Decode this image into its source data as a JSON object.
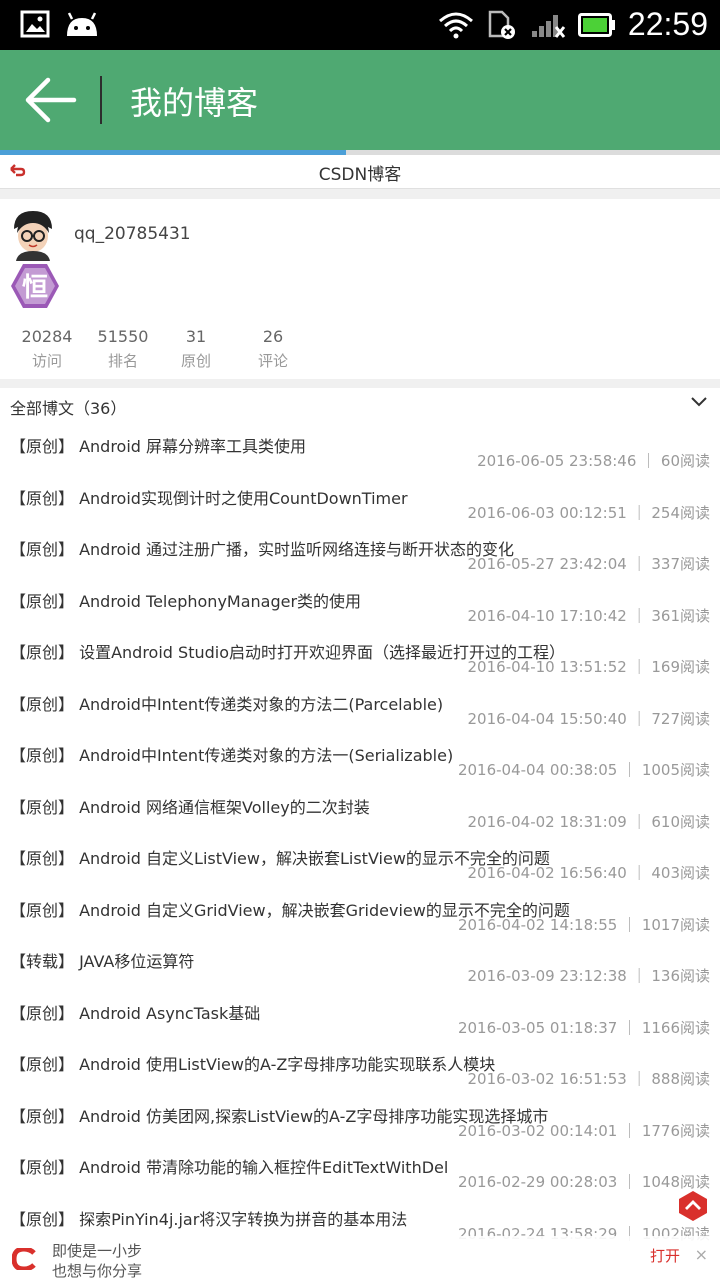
{
  "status_bar": {
    "time": "22:59"
  },
  "app_bar": {
    "title": "我的博客"
  },
  "loading": {
    "progress_percent": 48
  },
  "sub_bar": {
    "title": "CSDN博客"
  },
  "profile": {
    "username": "qq_20785431",
    "badge_char": "恒",
    "stats": [
      {
        "value": "20284",
        "label": "访问"
      },
      {
        "value": "51550",
        "label": "排名"
      },
      {
        "value": "31",
        "label": "原创"
      },
      {
        "value": "26",
        "label": "评论"
      }
    ]
  },
  "list_header": "全部博文（36）",
  "articles": [
    {
      "title": "【原创】 Android 屏幕分辨率工具类使用",
      "meta": "2016-06-05 23:58:46 ｜ 60阅读"
    },
    {
      "title": "【原创】 Android实现倒计时之使用CountDownTimer",
      "meta": "2016-06-03 00:12:51 ｜ 254阅读"
    },
    {
      "title": "【原创】 Android 通过注册广播，实时监听网络连接与断开状态的变化",
      "meta": "2016-05-27 23:42:04 ｜ 337阅读"
    },
    {
      "title": "【原创】 Android TelephonyManager类的使用",
      "meta": "2016-04-10 17:10:42 ｜ 361阅读"
    },
    {
      "title": "【原创】 设置Android Studio启动时打开欢迎界面（选择最近打开过的工程）",
      "meta": "2016-04-10 13:51:52 ｜ 169阅读"
    },
    {
      "title": "【原创】 Android中Intent传递类对象的方法二(Parcelable)",
      "meta": "2016-04-04 15:50:40 ｜ 727阅读"
    },
    {
      "title": "【原创】 Android中Intent传递类对象的方法一(Serializable)",
      "meta": "2016-04-04 00:38:05 ｜ 1005阅读"
    },
    {
      "title": "【原创】 Android 网络通信框架Volley的二次封装",
      "meta": "2016-04-02 18:31:09 ｜ 610阅读"
    },
    {
      "title": "【原创】 Android 自定义ListView，解决嵌套ListView的显示不完全的问题",
      "meta": "2016-04-02 16:56:40 ｜ 403阅读"
    },
    {
      "title": "【原创】 Android 自定义GridView，解决嵌套Grideview的显示不完全的问题",
      "meta": "2016-04-02 14:18:55 ｜ 1017阅读"
    },
    {
      "title": "【转载】 JAVA移位运算符",
      "meta": "2016-03-09 23:12:38 ｜ 136阅读"
    },
    {
      "title": "【原创】 Android AsyncTask基础",
      "meta": "2016-03-05 01:18:37 ｜ 1166阅读"
    },
    {
      "title": "【原创】 Android 使用ListView的A-Z字母排序功能实现联系人模块",
      "meta": "2016-03-02 16:51:53 ｜ 888阅读"
    },
    {
      "title": "【原创】 Android 仿美团网,探索ListView的A-Z字母排序功能实现选择城市",
      "meta": "2016-03-02 00:14:01 ｜ 1776阅读"
    },
    {
      "title": "【原创】 Android 带清除功能的输入框控件EditTextWithDel",
      "meta": "2016-02-29 00:28:03 ｜ 1048阅读"
    },
    {
      "title": "【原创】 探索PinYin4j.jar将汉字转换为拼音的基本用法",
      "meta": "2016-02-24 13:58:29 ｜ 1002阅读"
    }
  ],
  "share_bar": {
    "line1": "即使是一小步",
    "line2": "也想与你分享",
    "open": "打开",
    "close": "×"
  },
  "colors": {
    "app_bar": "#4fa972",
    "progress": "#4b9fd7",
    "accent_red": "#d9302c"
  }
}
